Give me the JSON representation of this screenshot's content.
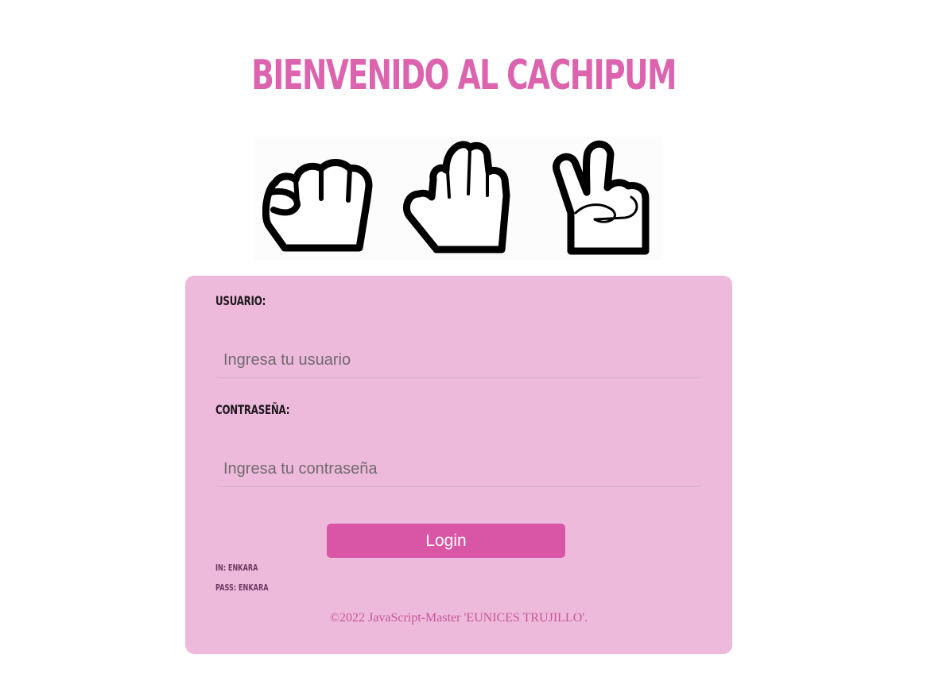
{
  "page": {
    "title": "BIENVENIDO AL CACHIPUM",
    "accent_color": "#dc63ad",
    "card_color": "#eebadb",
    "button_color": "#d955a6"
  },
  "hands": {
    "icons": [
      "fist-rock-icon",
      "open-hand-paper-icon",
      "victory-hand-scissors-icon"
    ]
  },
  "form": {
    "username_label": "USUARIO:",
    "username_placeholder": "Ingresa tu usuario",
    "username_value": "",
    "password_label": "CONTRASEÑA:",
    "password_placeholder": "Ingresa tu contraseña",
    "password_value": "",
    "login_label": "Login"
  },
  "hints": {
    "user_hint": "IN: ENKARA",
    "pass_hint": "PASS: ENKARA"
  },
  "footer": {
    "text": "©2022 JavaScript-Master 'EUNICES TRUJILLO'."
  }
}
